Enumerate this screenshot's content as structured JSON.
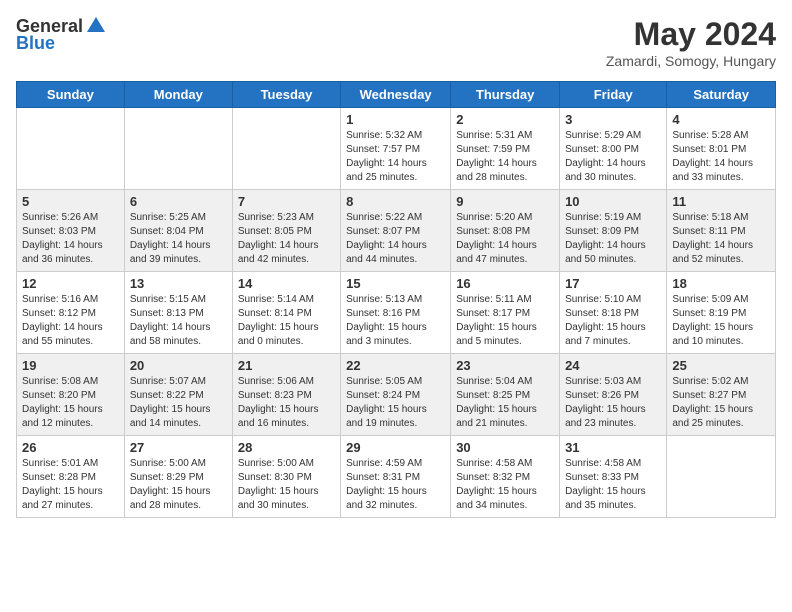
{
  "header": {
    "logo_line1": "General",
    "logo_line2": "Blue",
    "month_title": "May 2024",
    "location": "Zamardi, Somogy, Hungary"
  },
  "weekdays": [
    "Sunday",
    "Monday",
    "Tuesday",
    "Wednesday",
    "Thursday",
    "Friday",
    "Saturday"
  ],
  "weeks": [
    [
      {
        "day": "",
        "sunrise": "",
        "sunset": "",
        "daylight": ""
      },
      {
        "day": "",
        "sunrise": "",
        "sunset": "",
        "daylight": ""
      },
      {
        "day": "",
        "sunrise": "",
        "sunset": "",
        "daylight": ""
      },
      {
        "day": "1",
        "sunrise": "Sunrise: 5:32 AM",
        "sunset": "Sunset: 7:57 PM",
        "daylight": "Daylight: 14 hours and 25 minutes."
      },
      {
        "day": "2",
        "sunrise": "Sunrise: 5:31 AM",
        "sunset": "Sunset: 7:59 PM",
        "daylight": "Daylight: 14 hours and 28 minutes."
      },
      {
        "day": "3",
        "sunrise": "Sunrise: 5:29 AM",
        "sunset": "Sunset: 8:00 PM",
        "daylight": "Daylight: 14 hours and 30 minutes."
      },
      {
        "day": "4",
        "sunrise": "Sunrise: 5:28 AM",
        "sunset": "Sunset: 8:01 PM",
        "daylight": "Daylight: 14 hours and 33 minutes."
      }
    ],
    [
      {
        "day": "5",
        "sunrise": "Sunrise: 5:26 AM",
        "sunset": "Sunset: 8:03 PM",
        "daylight": "Daylight: 14 hours and 36 minutes."
      },
      {
        "day": "6",
        "sunrise": "Sunrise: 5:25 AM",
        "sunset": "Sunset: 8:04 PM",
        "daylight": "Daylight: 14 hours and 39 minutes."
      },
      {
        "day": "7",
        "sunrise": "Sunrise: 5:23 AM",
        "sunset": "Sunset: 8:05 PM",
        "daylight": "Daylight: 14 hours and 42 minutes."
      },
      {
        "day": "8",
        "sunrise": "Sunrise: 5:22 AM",
        "sunset": "Sunset: 8:07 PM",
        "daylight": "Daylight: 14 hours and 44 minutes."
      },
      {
        "day": "9",
        "sunrise": "Sunrise: 5:20 AM",
        "sunset": "Sunset: 8:08 PM",
        "daylight": "Daylight: 14 hours and 47 minutes."
      },
      {
        "day": "10",
        "sunrise": "Sunrise: 5:19 AM",
        "sunset": "Sunset: 8:09 PM",
        "daylight": "Daylight: 14 hours and 50 minutes."
      },
      {
        "day": "11",
        "sunrise": "Sunrise: 5:18 AM",
        "sunset": "Sunset: 8:11 PM",
        "daylight": "Daylight: 14 hours and 52 minutes."
      }
    ],
    [
      {
        "day": "12",
        "sunrise": "Sunrise: 5:16 AM",
        "sunset": "Sunset: 8:12 PM",
        "daylight": "Daylight: 14 hours and 55 minutes."
      },
      {
        "day": "13",
        "sunrise": "Sunrise: 5:15 AM",
        "sunset": "Sunset: 8:13 PM",
        "daylight": "Daylight: 14 hours and 58 minutes."
      },
      {
        "day": "14",
        "sunrise": "Sunrise: 5:14 AM",
        "sunset": "Sunset: 8:14 PM",
        "daylight": "Daylight: 15 hours and 0 minutes."
      },
      {
        "day": "15",
        "sunrise": "Sunrise: 5:13 AM",
        "sunset": "Sunset: 8:16 PM",
        "daylight": "Daylight: 15 hours and 3 minutes."
      },
      {
        "day": "16",
        "sunrise": "Sunrise: 5:11 AM",
        "sunset": "Sunset: 8:17 PM",
        "daylight": "Daylight: 15 hours and 5 minutes."
      },
      {
        "day": "17",
        "sunrise": "Sunrise: 5:10 AM",
        "sunset": "Sunset: 8:18 PM",
        "daylight": "Daylight: 15 hours and 7 minutes."
      },
      {
        "day": "18",
        "sunrise": "Sunrise: 5:09 AM",
        "sunset": "Sunset: 8:19 PM",
        "daylight": "Daylight: 15 hours and 10 minutes."
      }
    ],
    [
      {
        "day": "19",
        "sunrise": "Sunrise: 5:08 AM",
        "sunset": "Sunset: 8:20 PM",
        "daylight": "Daylight: 15 hours and 12 minutes."
      },
      {
        "day": "20",
        "sunrise": "Sunrise: 5:07 AM",
        "sunset": "Sunset: 8:22 PM",
        "daylight": "Daylight: 15 hours and 14 minutes."
      },
      {
        "day": "21",
        "sunrise": "Sunrise: 5:06 AM",
        "sunset": "Sunset: 8:23 PM",
        "daylight": "Daylight: 15 hours and 16 minutes."
      },
      {
        "day": "22",
        "sunrise": "Sunrise: 5:05 AM",
        "sunset": "Sunset: 8:24 PM",
        "daylight": "Daylight: 15 hours and 19 minutes."
      },
      {
        "day": "23",
        "sunrise": "Sunrise: 5:04 AM",
        "sunset": "Sunset: 8:25 PM",
        "daylight": "Daylight: 15 hours and 21 minutes."
      },
      {
        "day": "24",
        "sunrise": "Sunrise: 5:03 AM",
        "sunset": "Sunset: 8:26 PM",
        "daylight": "Daylight: 15 hours and 23 minutes."
      },
      {
        "day": "25",
        "sunrise": "Sunrise: 5:02 AM",
        "sunset": "Sunset: 8:27 PM",
        "daylight": "Daylight: 15 hours and 25 minutes."
      }
    ],
    [
      {
        "day": "26",
        "sunrise": "Sunrise: 5:01 AM",
        "sunset": "Sunset: 8:28 PM",
        "daylight": "Daylight: 15 hours and 27 minutes."
      },
      {
        "day": "27",
        "sunrise": "Sunrise: 5:00 AM",
        "sunset": "Sunset: 8:29 PM",
        "daylight": "Daylight: 15 hours and 28 minutes."
      },
      {
        "day": "28",
        "sunrise": "Sunrise: 5:00 AM",
        "sunset": "Sunset: 8:30 PM",
        "daylight": "Daylight: 15 hours and 30 minutes."
      },
      {
        "day": "29",
        "sunrise": "Sunrise: 4:59 AM",
        "sunset": "Sunset: 8:31 PM",
        "daylight": "Daylight: 15 hours and 32 minutes."
      },
      {
        "day": "30",
        "sunrise": "Sunrise: 4:58 AM",
        "sunset": "Sunset: 8:32 PM",
        "daylight": "Daylight: 15 hours and 34 minutes."
      },
      {
        "day": "31",
        "sunrise": "Sunrise: 4:58 AM",
        "sunset": "Sunset: 8:33 PM",
        "daylight": "Daylight: 15 hours and 35 minutes."
      },
      {
        "day": "",
        "sunrise": "",
        "sunset": "",
        "daylight": ""
      }
    ]
  ]
}
